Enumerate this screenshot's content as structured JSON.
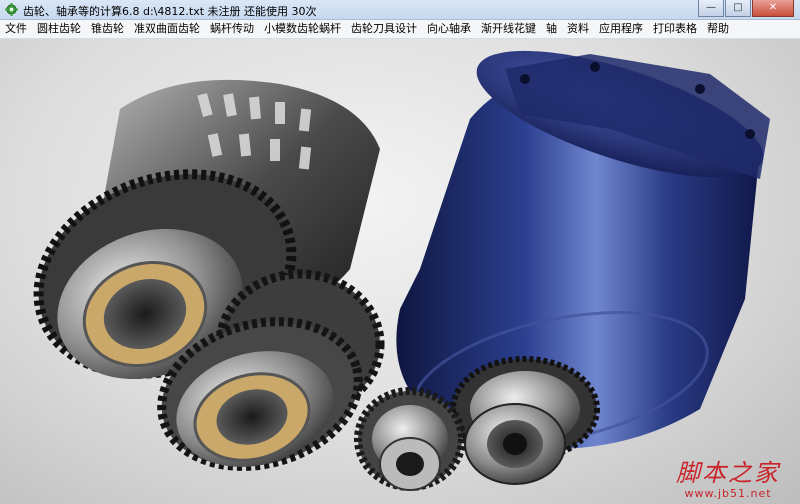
{
  "window": {
    "title": "齿轮、轴承等的计算6.8   d:\\4812.txt 未注册 还能使用 30次",
    "icon": "gear-app-icon",
    "caption_buttons": {
      "minimize": "—",
      "maximize": "□",
      "close": "✕"
    }
  },
  "menu": [
    {
      "label": "文件"
    },
    {
      "label": "圆柱齿轮"
    },
    {
      "label": "锥齿轮"
    },
    {
      "label": "准双曲面齿轮"
    },
    {
      "label": "蜗杆传动"
    },
    {
      "label": "小模数齿轮蜗杆"
    },
    {
      "label": "齿轮刀具设计"
    },
    {
      "label": "向心轴承"
    },
    {
      "label": "渐开线花键"
    },
    {
      "label": "轴"
    },
    {
      "label": "资料"
    },
    {
      "label": "应用程序"
    },
    {
      "label": "打印表格"
    },
    {
      "label": "帮助"
    }
  ],
  "splash": {
    "description_icon": "gearbox-render-image"
  },
  "watermark": {
    "cn": "脚本之家",
    "url": "www.jb51.net"
  },
  "colors": {
    "titlebar": "#c6d8ef",
    "menubar": "#f5f6f8",
    "motor_blue": "#2a3a7a",
    "gear_steel": "#555555",
    "watermark": "#c8242a"
  }
}
